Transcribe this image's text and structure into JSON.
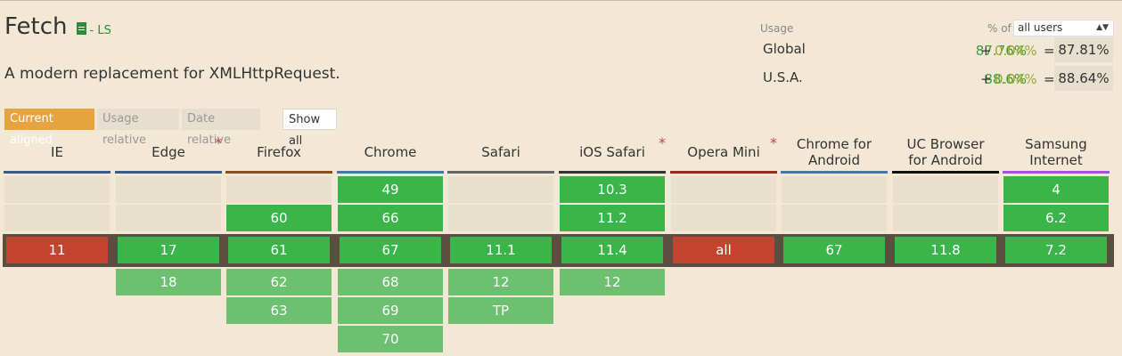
{
  "feature": {
    "title": "Fetch",
    "spec_status": "- LS",
    "description": "A modern replacement for XMLHttpRequest."
  },
  "usage": {
    "label": "Usage",
    "pct_of_label": "% of",
    "selector_value": "all users",
    "rows": [
      {
        "region": "Global",
        "full": "87.76%",
        "plus": "+",
        "partial": "0.04%",
        "eq": "=",
        "total": "87.81%"
      },
      {
        "region": "U.S.A.",
        "full": "88.6%",
        "plus": "+",
        "partial": "0.04%",
        "eq": "=",
        "total": "88.64%"
      }
    ]
  },
  "tabs": {
    "current_aligned": "Current aligned",
    "usage_relative": "Usage relative",
    "date_relative": "Date relative",
    "show_all": "Show all"
  },
  "colors": {
    "supported": "#39b54a",
    "partial_future": "#6cc070",
    "unsupported": "#c44230",
    "empty": "#e8dfcc",
    "accent": "#e7a340"
  },
  "browsers": [
    {
      "name": "IE",
      "star": false,
      "bar": "#3c5a87",
      "rows": [
        {
          "v": "",
          "s": "empty"
        },
        {
          "v": "",
          "s": "empty"
        },
        {
          "v": "11",
          "s": "none"
        }
      ]
    },
    {
      "name": "Edge",
      "star": true,
      "bar": "#3c5a87",
      "rows": [
        {
          "v": "",
          "s": "empty"
        },
        {
          "v": "",
          "s": "empty"
        },
        {
          "v": "17",
          "s": "full"
        },
        {
          "v": "18",
          "s": "partial"
        }
      ]
    },
    {
      "name": "Firefox",
      "star": false,
      "bar": "#8a4f1f",
      "rows": [
        {
          "v": "",
          "s": "empty"
        },
        {
          "v": "60",
          "s": "full"
        },
        {
          "v": "61",
          "s": "full"
        },
        {
          "v": "62",
          "s": "partial"
        },
        {
          "v": "63",
          "s": "partial"
        }
      ]
    },
    {
      "name": "Chrome",
      "star": false,
      "bar": "#4a74aa",
      "rows": [
        {
          "v": "49",
          "s": "full"
        },
        {
          "v": "66",
          "s": "full"
        },
        {
          "v": "67",
          "s": "full"
        },
        {
          "v": "68",
          "s": "partial"
        },
        {
          "v": "69",
          "s": "partial"
        },
        {
          "v": "70",
          "s": "partial"
        }
      ]
    },
    {
      "name": "Safari",
      "star": false,
      "bar": "#666666",
      "rows": [
        {
          "v": "",
          "s": "empty"
        },
        {
          "v": "",
          "s": "empty"
        },
        {
          "v": "11.1",
          "s": "full"
        },
        {
          "v": "12",
          "s": "partial"
        },
        {
          "v": "TP",
          "s": "partial"
        }
      ]
    },
    {
      "name": "iOS Safari",
      "star": true,
      "bar": "#333333",
      "rows": [
        {
          "v": "10.3",
          "s": "full"
        },
        {
          "v": "11.2",
          "s": "full"
        },
        {
          "v": "11.4",
          "s": "full"
        },
        {
          "v": "12",
          "s": "partial"
        }
      ]
    },
    {
      "name": "Opera Mini",
      "star": true,
      "bar": "#9b2b20",
      "rows": [
        {
          "v": "",
          "s": "empty"
        },
        {
          "v": "",
          "s": "empty"
        },
        {
          "v": "all",
          "s": "none"
        }
      ]
    },
    {
      "name": "Chrome for Android",
      "star": false,
      "bar": "#4a74aa",
      "rows": [
        {
          "v": "",
          "s": "empty"
        },
        {
          "v": "",
          "s": "empty"
        },
        {
          "v": "67",
          "s": "full"
        }
      ]
    },
    {
      "name": "UC Browser for Android",
      "star": false,
      "bar": "#111111",
      "rows": [
        {
          "v": "",
          "s": "empty"
        },
        {
          "v": "",
          "s": "empty"
        },
        {
          "v": "11.8",
          "s": "full"
        }
      ]
    },
    {
      "name": "Samsung Internet",
      "star": false,
      "bar": "#9a57d6",
      "rows": [
        {
          "v": "4",
          "s": "full"
        },
        {
          "v": "6.2",
          "s": "full"
        },
        {
          "v": "7.2",
          "s": "full"
        }
      ]
    }
  ]
}
